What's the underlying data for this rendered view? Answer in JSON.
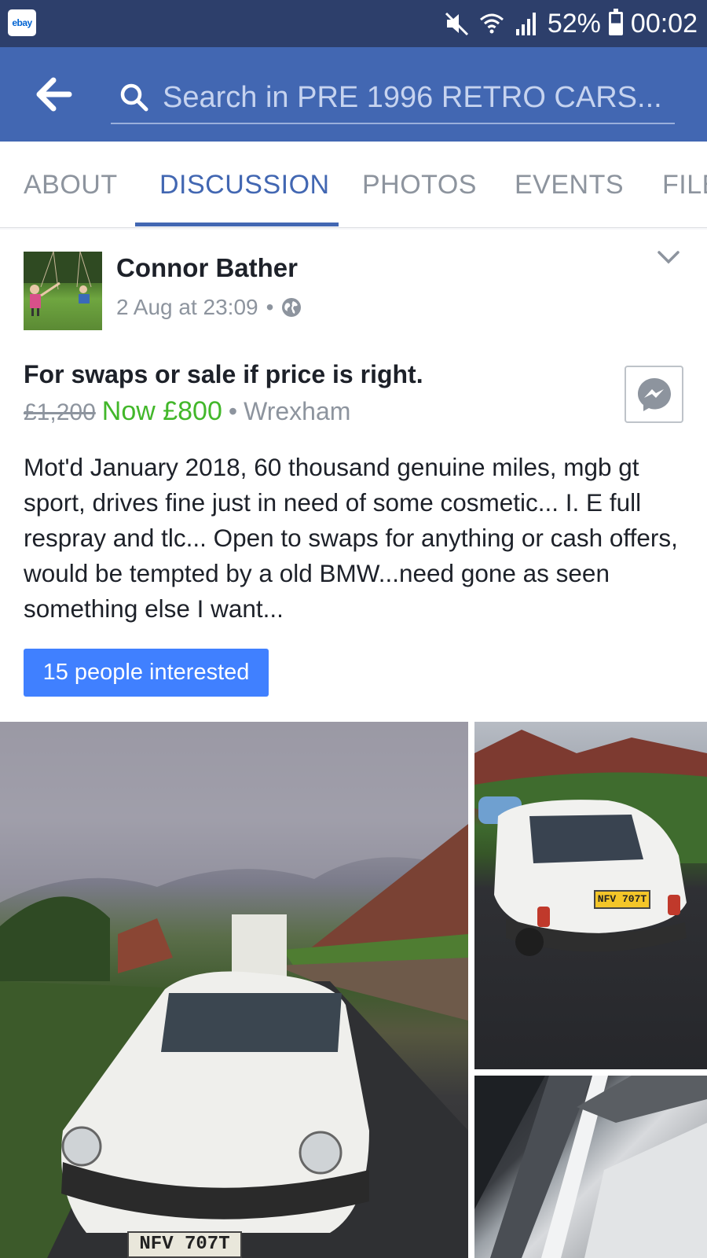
{
  "status_bar": {
    "app_icon_label": "ebay",
    "battery": "52%",
    "time": "00:02",
    "battery_level": 0.52
  },
  "search": {
    "placeholder": "Search in PRE 1996 RETRO CARS..."
  },
  "tabs": [
    {
      "label": "ABOUT",
      "active": false
    },
    {
      "label": "DISCUSSION",
      "active": true
    },
    {
      "label": "PHOTOS",
      "active": false
    },
    {
      "label": "EVENTS",
      "active": false
    },
    {
      "label": "FILES",
      "active": false
    }
  ],
  "post": {
    "author": "Connor Bather",
    "timestamp": "2 Aug at 23:09",
    "separator": "•",
    "listing": {
      "title": "For swaps or sale if price is right.",
      "old_price": "£1,200",
      "new_price": "Now £800",
      "location": "Wrexham"
    },
    "body": "Mot'd January 2018, 60 thousand genuine miles, mgb gt sport, drives fine just in need of some cosmetic... I. E full respray and tlc... Open to swaps for anything or cash offers, would be tempted by a old BMW...need gone as seen something else I want...",
    "interested_label": "15 people interested",
    "photos": {
      "main_plate": "NFV 707T",
      "side_plate": "NFV 707T"
    }
  },
  "colors": {
    "status_bar": "#2d3f6b",
    "header": "#4267b2",
    "active_tab": "#4267b2",
    "price_green": "#42b72a",
    "interested_blue": "#4080ff"
  }
}
